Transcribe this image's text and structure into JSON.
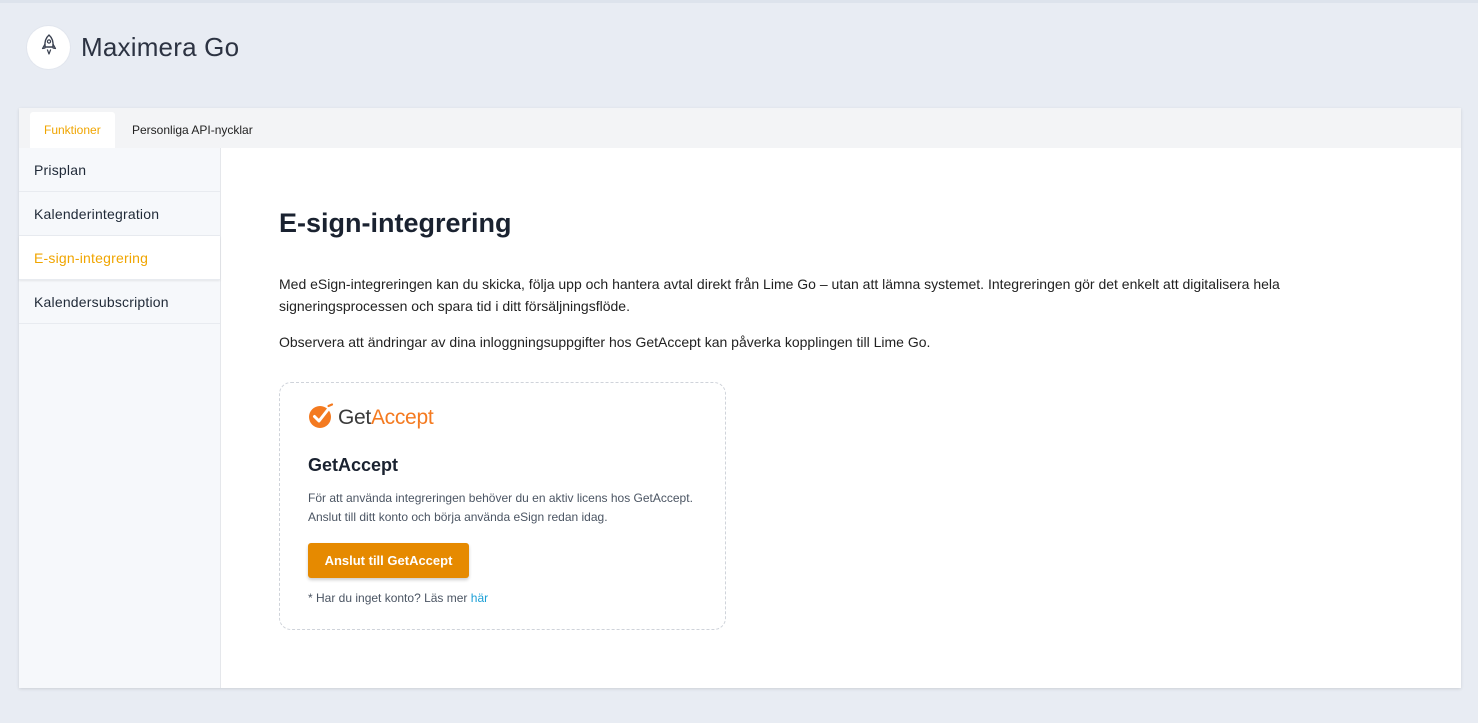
{
  "app": {
    "title": "Maximera Go",
    "logo_icon": "rocket-icon"
  },
  "tabs": [
    {
      "label": "Funktioner",
      "active": true
    },
    {
      "label": "Personliga API-nycklar",
      "active": false
    }
  ],
  "sidebar": {
    "items": [
      {
        "label": "Prisplan",
        "active": false
      },
      {
        "label": "Kalenderintegration",
        "active": false
      },
      {
        "label": "E-sign-integrering",
        "active": true
      },
      {
        "label": "Kalendersubscription",
        "active": false
      }
    ]
  },
  "main": {
    "title": "E-sign-integrering",
    "paragraph1": "Med eSign-integreringen kan du skicka, följa upp och hantera avtal direkt från Lime Go – utan att lämna systemet. Integreringen gör det enkelt att digitalisera hela signeringsprocessen och spara tid i ditt försäljningsflöde.",
    "paragraph2": "Observera att ändringar av dina inloggningsuppgifter hos GetAccept kan påverka kopplingen till Lime Go."
  },
  "card": {
    "logo_part1": "Get",
    "logo_part2": "Accept",
    "logo_icon": "getaccept-check-icon",
    "title": "GetAccept",
    "description": "För att använda integreringen behöver du en aktiv licens hos GetAccept. Anslut till ditt konto och börja använda eSign redan idag.",
    "button_label": "Anslut till GetAccept",
    "note_text": "* Har du inget konto? Läs mer ",
    "note_link": "här"
  },
  "colors": {
    "accent": "#f0a500",
    "button": "#e68a00",
    "brand_orange": "#f47a20",
    "link": "#1a9fd6",
    "background": "#e8ecf3"
  }
}
